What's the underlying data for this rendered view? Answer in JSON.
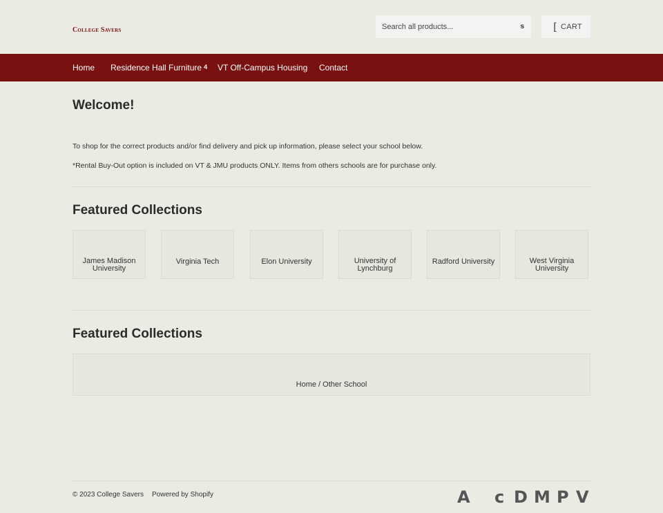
{
  "header": {
    "logo": "College Savers",
    "search": {
      "placeholder": "Search all products..."
    },
    "search_button_glyph": "s",
    "cart": {
      "icon_glyph": "[",
      "label": "CART"
    }
  },
  "nav": {
    "items": [
      {
        "label": "Home"
      },
      {
        "label": "Residence Hall Furniture",
        "badge": "4"
      },
      {
        "label": "VT Off-Campus Housing"
      },
      {
        "label": "Contact"
      }
    ]
  },
  "main": {
    "welcome_title": "Welcome!",
    "paragraphs": [
      "To shop for the correct products and/or find delivery and pick up information, please select your school below.",
      "*Rental Buy-Out option is included on VT & JMU products ONLY. Items from others schools are for purchase only."
    ],
    "featured_title_1": "Featured Collections",
    "collections": [
      {
        "label": "James Madison University"
      },
      {
        "label": "Virginia Tech"
      },
      {
        "label": "Elon University"
      },
      {
        "label": "University of Lynchburg"
      },
      {
        "label": "Radford University"
      },
      {
        "label": "West Virginia University"
      }
    ],
    "featured_title_2": "Featured Collections",
    "breadcrumb": {
      "home": "Home",
      "separator": " / ",
      "current": "Other School"
    }
  },
  "footer": {
    "copyright": "© 2023 College Savers",
    "powered_by": "Powered by Shopify",
    "payment_icons": [
      "A",
      "c",
      "D",
      "M",
      "P",
      "V"
    ]
  },
  "colors": {
    "background": "#ebeae3",
    "nav_background": "#791111",
    "logo": "#7a1212",
    "tile_background": "#e7e6df"
  }
}
